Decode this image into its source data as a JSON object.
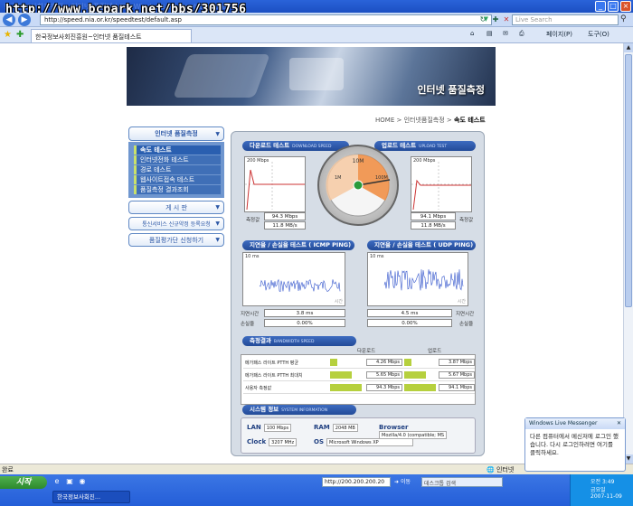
{
  "window": {
    "title": "한국정보사회진흥원 - 인터넷 품질테스트 - Windows Internet Explorer",
    "watermark": "http://www.bcpark.net/bbs/301756"
  },
  "addressbar": {
    "url": "http://speed.nia.or.kr/speedtest/default.asp",
    "live_search_placeholder": "Live Search"
  },
  "tabbar": {
    "tab_title": "한국정보사회진흥원~인터넷 품질테스트",
    "page_menu": "페이지(P)",
    "tools_menu": "도구(O)"
  },
  "page": {
    "banner_title": "인터넷 품질측정",
    "breadcrumb": {
      "home": "HOME",
      "sep1": ">",
      "level1": "인터넷품질측정",
      "sep2": ">",
      "current": "속도 테스트"
    }
  },
  "sidebar": {
    "header": "인터넷 품질측정",
    "items": [
      {
        "label": "속도 테스트",
        "active": true
      },
      {
        "label": "인터넷전화 테스트"
      },
      {
        "label": "경로 테스트"
      },
      {
        "label": "웹사이트접속 테스트"
      },
      {
        "label": "품질측정 결과조회"
      }
    ],
    "board": "게 시 판",
    "register": "통신서비스 신규약정 등록요청",
    "apply": "품질평가단 신청하기"
  },
  "test": {
    "download": {
      "title": "다운로드 테스트",
      "subtitle": "DOWNLOAD SPEED",
      "scale": "200 Mbps",
      "unit_label": "측정값",
      "mbps": "94.3 Mbps",
      "mbytes": "11.8 MB/s"
    },
    "upload": {
      "title": "업로드 테스트",
      "subtitle": "UPLOAD TEST",
      "scale": "200 Mbps",
      "unit_label": "측정값",
      "mbps": "94.1 Mbps",
      "mbytes": "11.8 MB/s"
    },
    "gauge": {
      "labels": [
        "1M",
        "10M",
        "100M"
      ],
      "value_mbps": 94.3
    },
    "icmp": {
      "title": "지연율 / 손실율 테스트 ( ICMP PING)",
      "scale": "10 ms",
      "time_label": "시간",
      "delay_label": "지연시간",
      "delay": "3.8 ms",
      "loss_label": "손실율",
      "loss": "0.00%"
    },
    "udp": {
      "title": "지연율 / 손실율 테스트 ( UDP PING)",
      "scale": "10 ms",
      "time_label": "시간",
      "delay_label": "지연시간",
      "delay": "4.5 ms",
      "loss_label": "손실율",
      "loss": "0.00%"
    },
    "results": {
      "title": "측정결과",
      "subtitle": "BANDWIDTH SPEED",
      "col_down": "다운로드",
      "col_up": "업로드",
      "rows": [
        {
          "name": "메가패스 라이트 PTTH 평균",
          "down": "4.26 Mbps",
          "down_frac": 0.22,
          "up": "3.87 Mbps",
          "up_frac": 0.2
        },
        {
          "name": "메가패스 라이트 PTTH 최대치",
          "down": "5.65 Mbps",
          "down_frac": 0.62,
          "up": "5.67 Mbps",
          "up_frac": 0.62
        },
        {
          "name": "사용자 측정값",
          "down": "94.3 Mbps",
          "down_frac": 0.92,
          "up": "94.1 Mbps",
          "up_frac": 0.92
        }
      ]
    },
    "system": {
      "title": "시스템 정보",
      "subtitle": "SYSTEM INFORMATION",
      "lan_label": "LAN",
      "lan": "100 Mbps",
      "ram_label": "RAM",
      "ram": "2048 MB",
      "browser_label": "Browser",
      "browser": "Mozilla/4.0 (compatible; MS",
      "clock_label": "Clock",
      "clock": "3207 MHz",
      "os_label": "OS",
      "os": "Microsoft Windows XP"
    }
  },
  "statusbar": {
    "left": "완료",
    "right": "인터넷"
  },
  "messenger": {
    "title": "Windows Live Messenger",
    "body": "다른 컴퓨터에서 메신저에 로그인 했습니다. 다시 로그인하려면 여기를 클릭하세요."
  },
  "taskbar": {
    "start": "시작",
    "address": "http://200.200.200.20",
    "go": "이동",
    "search": "데스크톱 검색",
    "task": "한국정보사회진...",
    "time": "오전 3:49",
    "day": "금요일",
    "date": "2007-11-09"
  }
}
